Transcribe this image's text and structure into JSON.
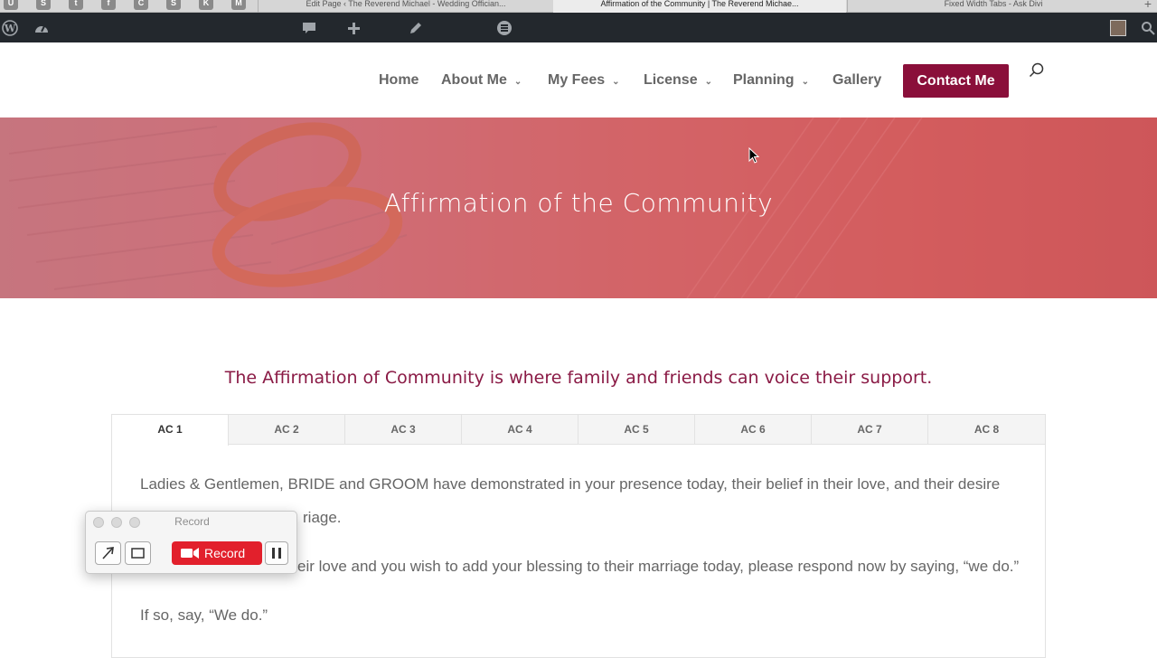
{
  "browser": {
    "bookmarks": [
      "U",
      "S",
      "t",
      "f",
      "C",
      "S",
      "K",
      "M"
    ],
    "tabs": [
      {
        "title": "Edit Page ‹ The Reverend Michael - Wedding Offician..."
      },
      {
        "title": "Affirmation of the Community | The Reverend Michae..."
      },
      {
        "title": "Fixed Width Tabs - Ask Divi"
      }
    ]
  },
  "nav": {
    "items": [
      {
        "label": "Home"
      },
      {
        "label": "About Me"
      },
      {
        "label": "My Fees"
      },
      {
        "label": "License"
      },
      {
        "label": "Planning"
      },
      {
        "label": "Gallery"
      }
    ],
    "contact_label": "Contact Me"
  },
  "hero": {
    "title": "Affirmation of the Community"
  },
  "content": {
    "intro": "The Affirmation of Community is where family and friends can voice their support.",
    "tabs": [
      "AC 1",
      "AC 2",
      "AC 3",
      "AC 4",
      "AC 5",
      "AC 6",
      "AC 7",
      "AC 8"
    ],
    "active_tab": "AC 1",
    "para1_line1": "Ladies & Gentlemen, BRIDE and GROOM have demonstrated in your presence today, their belief in their love, and their desire",
    "para1_line2": "riage.",
    "para2": "eir love and you wish to add your blessing to their marriage today, please respond now by saying, “we do.”",
    "para3": "If so, say, “We do.”"
  },
  "recorder": {
    "title": "Record",
    "record_label": "Record"
  },
  "colors": {
    "accent": "#8a0f3a",
    "record_red": "#e2202c",
    "admin_bar": "#23282d"
  }
}
